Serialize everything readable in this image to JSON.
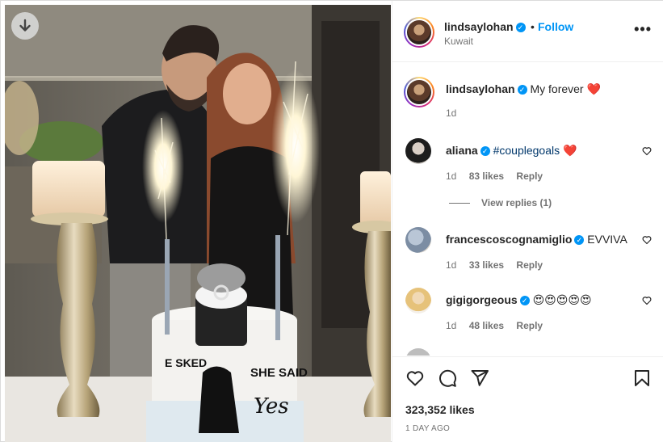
{
  "post": {
    "author": "lindsaylohan",
    "location": "Kuwait",
    "follow_label": "Follow",
    "separator": "•",
    "more_label": "•••"
  },
  "caption": {
    "username": "lindsaylohan",
    "text": "My forever",
    "emoji": "❤️",
    "time": "1d"
  },
  "comments": [
    {
      "username": "aliana",
      "text": "#couplegoals",
      "emoji": "❤️",
      "time": "1d",
      "likes": "83 likes",
      "reply": "Reply"
    },
    {
      "username": "francescoscognamiglio",
      "text": "EVVIVA",
      "emoji": "",
      "time": "1d",
      "likes": "33 likes",
      "reply": "Reply"
    },
    {
      "username": "gigigorgeous",
      "text": "",
      "emoji": "😍😍😍😍😍",
      "time": "1d",
      "likes": "48 likes",
      "reply": "Reply"
    }
  ],
  "view_replies": "View replies (1)",
  "footer": {
    "likes": "323,352 likes",
    "time": "1 DAY AGO"
  },
  "photo": {
    "cake_left_text": "E SKED",
    "cake_right_text": "SHE SAID",
    "cake_script": "Yes"
  },
  "colors": {
    "accent": "#0095f6",
    "heart": "#ed4956",
    "muted": "#737373"
  }
}
